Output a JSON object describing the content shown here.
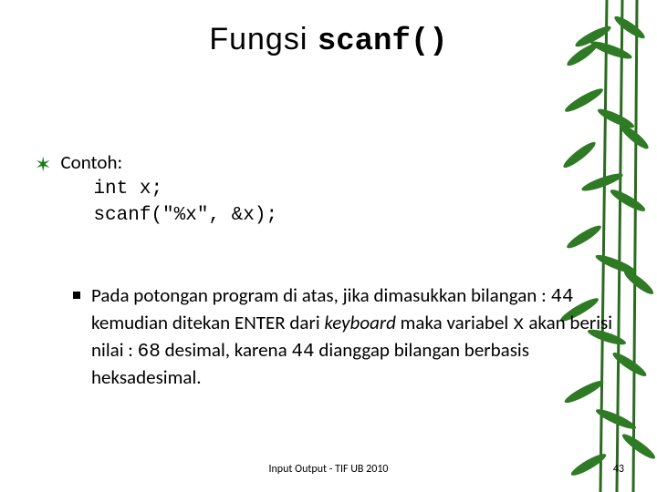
{
  "title": {
    "plain": "Fungsi ",
    "code": "scanf()"
  },
  "bullet": {
    "label": "Contoh:",
    "code_line1": "int x;",
    "code_line2": "scanf(\"%x\", &x);"
  },
  "sub": {
    "t1": "Pada potongan program di atas, jika dimasukkan bilangan : ",
    "n1": "44",
    "t2": " kemudian ditekan ENTER dari ",
    "kb": "keyboard",
    "t3": " maka variabel ",
    "var": "x",
    "t4": " akan berisi nilai : ",
    "n2": "68",
    "t5": " desimal, karena ",
    "n3": "44",
    "t6": " dianggap bilangan berbasis heksadesimal."
  },
  "footer": "Input Output - TIF UB 2010",
  "page": "43"
}
